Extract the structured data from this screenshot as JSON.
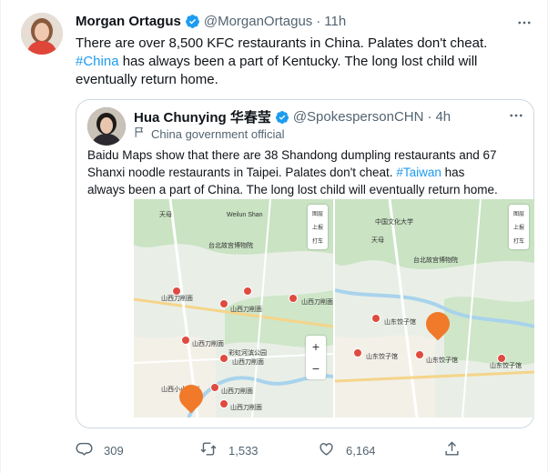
{
  "tweet": {
    "author_name": "Morgan Ortagus",
    "handle": "@MorganOrtagus",
    "separator": "·",
    "time": "11h",
    "text_lines": [
      "There are over 8,500 KFC restaurants in China. Palates don't cheat.",
      "has always been a part of Kentucky. The long lost child will",
      "eventually return home."
    ],
    "hashtag": "#China"
  },
  "quote": {
    "author_name": "Hua Chunying 华春莹",
    "handle": "@SpokespersonCHN",
    "separator": "·",
    "time": "4h",
    "label": "China government official",
    "text_lines": [
      "Baidu Maps show that there are 38 Shandong dumpling restaurants and 67",
      "Shanxi noodle restaurants in Taipei. Palates don't cheat.",
      "has",
      "always been a part of China. The long lost child will eventually return home."
    ],
    "hashtag": "#Taiwan"
  },
  "map_left": {
    "labels": [
      "天母",
      "Weilun Shan",
      "台北故宫博物院",
      "山西刀削面",
      "山西刀削面",
      "山西刀削面",
      "山西刀削面",
      "彩虹河滨公园",
      "山西刀削面",
      "山西小小刀削",
      "山西刀削面",
      "山西刀削面"
    ],
    "controls": [
      "图层",
      "上报",
      "打车"
    ]
  },
  "map_right": {
    "labels": [
      "中国文化大学",
      "天母",
      "台北故宫博物院",
      "山东饺子馆",
      "山东饺子馆",
      "山东饺子馆",
      "山东饺子馆"
    ],
    "controls": [
      "图层",
      "上报",
      "打车"
    ]
  },
  "actions": {
    "reply_count": "309",
    "retweet_count": "1,533",
    "like_count": "6,164"
  },
  "colors": {
    "accent": "#1d9bf0",
    "text": "#0f1419",
    "muted": "#536471",
    "border": "#cfd9de"
  },
  "icons": [
    "verified-badge-icon",
    "more-icon",
    "flag-icon",
    "reply-icon",
    "retweet-icon",
    "like-icon",
    "share-icon"
  ]
}
